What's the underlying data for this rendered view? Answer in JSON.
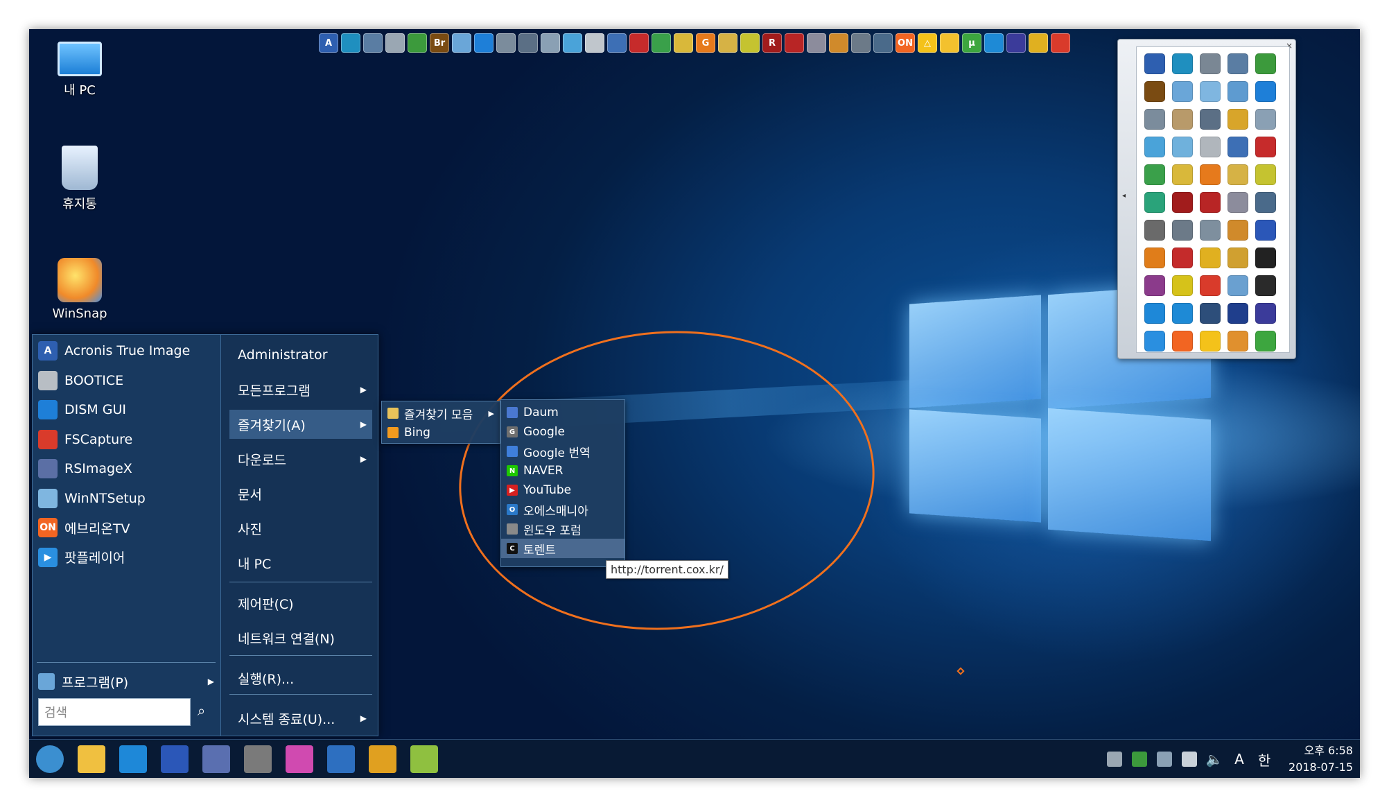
{
  "desktop": {
    "icons": [
      {
        "label": "내 PC"
      },
      {
        "label": "휴지통"
      },
      {
        "label": "WinSnap"
      }
    ]
  },
  "quick_launch": {
    "icons": [
      {
        "icon": "acronis-icon",
        "text": "A",
        "color": "#2e5fb0"
      },
      {
        "icon": "disk-icon",
        "text": "",
        "color": "#1f8fbf"
      },
      {
        "icon": "backup-icon",
        "text": "",
        "color": "#5a7da3"
      },
      {
        "icon": "drive-icon",
        "text": "",
        "color": "#9aa7b3"
      },
      {
        "icon": "hdd-icon",
        "text": "",
        "color": "#3c9a3c"
      },
      {
        "icon": "bridge-icon",
        "text": "Br",
        "color": "#7a4b12"
      },
      {
        "icon": "files-icon",
        "text": "",
        "color": "#6aa6d8"
      },
      {
        "icon": "windows-icon",
        "text": "",
        "color": "#1e7fd8"
      },
      {
        "icon": "network-icon",
        "text": "",
        "color": "#7b8c9c"
      },
      {
        "icon": "tools-icon",
        "text": "",
        "color": "#5b6f85"
      },
      {
        "icon": "usb-icon",
        "text": "",
        "color": "#8aa0b4"
      },
      {
        "icon": "phone-icon",
        "text": "",
        "color": "#4aa3d9"
      },
      {
        "icon": "bootice-icon",
        "text": "",
        "color": "#c0c6cc"
      },
      {
        "icon": "monitor-icon",
        "text": "",
        "color": "#3d6fb5"
      },
      {
        "icon": "car-icon",
        "text": "",
        "color": "#c62b2b"
      },
      {
        "icon": "paint-icon",
        "text": "",
        "color": "#3aa04a"
      },
      {
        "icon": "pinwheel-icon",
        "text": "",
        "color": "#d9b83a"
      },
      {
        "icon": "g-icon",
        "text": "G",
        "color": "#e67a1c"
      },
      {
        "icon": "wizard-icon",
        "text": "",
        "color": "#d6b245"
      },
      {
        "icon": "cube-icon",
        "text": "",
        "color": "#c5c330"
      },
      {
        "icon": "r-icon",
        "text": "R",
        "color": "#a11c1c"
      },
      {
        "icon": "dice-icon",
        "text": "",
        "color": "#b82525"
      },
      {
        "icon": "cd-icon",
        "text": "",
        "color": "#8c8c9c"
      },
      {
        "icon": "box-icon",
        "text": "",
        "color": "#d08a2b"
      },
      {
        "icon": "usb-stick-icon",
        "text": "",
        "color": "#6c7a88"
      },
      {
        "icon": "hdd2-icon",
        "text": "",
        "color": "#4a6a8a"
      },
      {
        "icon": "everon-icon",
        "text": "ON",
        "color": "#f26522"
      },
      {
        "icon": "triangle-icon",
        "text": "△",
        "color": "#f4c21a"
      },
      {
        "icon": "face-icon",
        "text": "",
        "color": "#f3c12e"
      },
      {
        "icon": "utorrent-icon",
        "text": "µ",
        "color": "#3da63f"
      },
      {
        "icon": "teamviewer-icon",
        "text": "",
        "color": "#1e8ad6"
      },
      {
        "icon": "chip-icon",
        "text": "",
        "color": "#3b3b9a"
      },
      {
        "icon": "keys-icon",
        "text": "",
        "color": "#e0b020"
      },
      {
        "icon": "fscapture-icon",
        "text": "",
        "color": "#d93b2b"
      }
    ]
  },
  "icon_panel": {
    "close": "×",
    "arrow": "◂",
    "cells": [
      {
        "icon": "acronis-icon",
        "color": "#2e5fb0"
      },
      {
        "icon": "disk-icon",
        "color": "#1f8fbf"
      },
      {
        "icon": "drive-icon",
        "color": "#7a8794"
      },
      {
        "icon": "backup-icon",
        "color": "#5a7da3"
      },
      {
        "icon": "hdd-icon",
        "color": "#3c9a3c"
      },
      {
        "icon": "bridge-icon",
        "color": "#7a4b12"
      },
      {
        "icon": "files-icon",
        "color": "#6aa6d8"
      },
      {
        "icon": "notes-icon",
        "color": "#7fb6e0"
      },
      {
        "icon": "puzzle-icon",
        "color": "#5e9bd0"
      },
      {
        "icon": "windows-icon",
        "color": "#1e7fd8"
      },
      {
        "icon": "network-icon",
        "color": "#7b8c9c"
      },
      {
        "icon": "printer-icon",
        "color": "#b89a6a"
      },
      {
        "icon": "tools-icon",
        "color": "#5b6f85"
      },
      {
        "icon": "gear-icon",
        "color": "#d8a52a"
      },
      {
        "icon": "usb-icon",
        "color": "#8aa0b4"
      },
      {
        "icon": "phone-icon",
        "color": "#4aa3d9"
      },
      {
        "icon": "tablet-icon",
        "color": "#6fb1dc"
      },
      {
        "icon": "bootice-icon",
        "color": "#b0b6bc"
      },
      {
        "icon": "monitor-icon",
        "color": "#3d6fb5"
      },
      {
        "icon": "car-icon",
        "color": "#c62b2b"
      },
      {
        "icon": "paint-icon",
        "color": "#3aa04a"
      },
      {
        "icon": "pinwheel-icon",
        "color": "#d9b83a"
      },
      {
        "icon": "g-icon",
        "color": "#e67a1c"
      },
      {
        "icon": "wizard-icon",
        "color": "#d6b245"
      },
      {
        "icon": "cube-icon",
        "color": "#c5c330"
      },
      {
        "icon": "rh-icon",
        "color": "#2aa37a"
      },
      {
        "icon": "r-icon",
        "color": "#a11c1c"
      },
      {
        "icon": "dice-icon",
        "color": "#b82525"
      },
      {
        "icon": "cd-icon",
        "color": "#8c8c9c"
      },
      {
        "icon": "hdd2-icon",
        "color": "#4a6a8a"
      },
      {
        "icon": "drive2-icon",
        "color": "#6a6a6a"
      },
      {
        "icon": "usb-stick-icon",
        "color": "#6c7a88"
      },
      {
        "icon": "ram-icon",
        "color": "#7e8f9e"
      },
      {
        "icon": "box-icon",
        "color": "#d08a2b"
      },
      {
        "icon": "save-icon",
        "color": "#2b57b8"
      },
      {
        "icon": "magnifier-icon",
        "color": "#e07d1a"
      },
      {
        "icon": "np-icon",
        "color": "#c42b2b"
      },
      {
        "icon": "keys-icon",
        "color": "#e0b020"
      },
      {
        "icon": "wand-icon",
        "color": "#d0a030"
      },
      {
        "icon": "7z-icon",
        "color": "#222222"
      },
      {
        "icon": "winrar-icon",
        "color": "#8b3b8b"
      },
      {
        "icon": "pdf-icon",
        "color": "#d6c21a"
      },
      {
        "icon": "fscapture-icon",
        "color": "#d93b2b"
      },
      {
        "icon": "winsnap-icon",
        "color": "#6aa0d0"
      },
      {
        "icon": "display-icon",
        "color": "#2a2a2a"
      },
      {
        "icon": "ie-icon",
        "color": "#1e88d8"
      },
      {
        "icon": "teamviewer-icon",
        "color": "#1e8ad6"
      },
      {
        "icon": "diagram-icon",
        "color": "#2d4e7a"
      },
      {
        "icon": "fc-icon",
        "color": "#1f3e8c"
      },
      {
        "icon": "chip-icon",
        "color": "#3b3b9a"
      },
      {
        "icon": "play-icon",
        "color": "#2a8fe0"
      },
      {
        "icon": "everon-icon",
        "color": "#f26522"
      },
      {
        "icon": "triangle-icon",
        "color": "#f4c21a"
      },
      {
        "icon": "face-icon",
        "color": "#e0902e"
      },
      {
        "icon": "utorrent-icon",
        "color": "#3da63f"
      }
    ]
  },
  "start_menu": {
    "pinned": [
      {
        "label": "Acronis True Image",
        "icon": "acronis-icon",
        "glyph": "A",
        "color": "#2e5fb0"
      },
      {
        "label": "BOOTICE",
        "icon": "bootice-icon",
        "glyph": "",
        "color": "#b8bec4"
      },
      {
        "label": "DISM GUI",
        "icon": "windows-icon",
        "glyph": "",
        "color": "#1e7fd8"
      },
      {
        "label": "FSCapture",
        "icon": "fscapture-icon",
        "glyph": "",
        "color": "#d93b2b"
      },
      {
        "label": "RSImageX",
        "icon": "rsimagex-icon",
        "glyph": "",
        "color": "#5b6fa5"
      },
      {
        "label": "WinNTSetup",
        "icon": "winntsetup-icon",
        "glyph": "",
        "color": "#7fb6e0"
      },
      {
        "label": "에브리온TV",
        "icon": "everon-icon",
        "glyph": "ON",
        "color": "#f26522"
      },
      {
        "label": "팟플레이어",
        "icon": "potplayer-icon",
        "glyph": "▶",
        "color": "#2a8fe0"
      }
    ],
    "programs": {
      "label": "프로그램(P)",
      "arrow": "▶"
    },
    "search_placeholder": "검색",
    "search_icon": "⌕",
    "right": [
      {
        "label": "Administrator",
        "arrow": ""
      },
      {
        "label": "모든프로그램",
        "arrow": "▶"
      },
      {
        "label": "즐겨찾기(A)",
        "arrow": "▶"
      },
      {
        "label": "다운로드",
        "arrow": "▶"
      },
      {
        "label": "문서",
        "arrow": ""
      },
      {
        "label": "사진",
        "arrow": ""
      },
      {
        "label": "내 PC",
        "arrow": ""
      },
      {
        "label": "제어판(C)",
        "arrow": ""
      },
      {
        "label": "네트워크 연결(N)",
        "arrow": ""
      },
      {
        "label": "실행(R)...",
        "arrow": ""
      },
      {
        "label": "시스템 종료(U)...",
        "arrow": "▶"
      }
    ]
  },
  "favorites_menu": [
    {
      "label": "즐겨찾기 모음",
      "arrow": "▶",
      "icon": "folder-icon",
      "color": "#e8c25a"
    },
    {
      "label": "Bing",
      "arrow": "",
      "icon": "bing-icon",
      "color": "#f29a1e"
    }
  ],
  "favorites_bar_menu": [
    {
      "label": "Daum",
      "icon": "daum-icon",
      "glyph": "",
      "color": "#4a78d0"
    },
    {
      "label": "Google",
      "icon": "google-icon",
      "glyph": "G",
      "color": "#6f6f6f"
    },
    {
      "label": "Google 번역",
      "icon": "translate-icon",
      "glyph": "",
      "color": "#3f7fdb"
    },
    {
      "label": "NAVER",
      "icon": "naver-icon",
      "glyph": "N",
      "color": "#1ec800"
    },
    {
      "label": "YouTube",
      "icon": "youtube-icon",
      "glyph": "▶",
      "color": "#d62020"
    },
    {
      "label": "오에스매니아",
      "icon": "osmania-icon",
      "glyph": "O",
      "color": "#2a78c8"
    },
    {
      "label": "윈도우 포럼",
      "icon": "winforum-icon",
      "glyph": "",
      "color": "#8a8a8a"
    },
    {
      "label": "토렌트",
      "icon": "torrent-icon",
      "glyph": "C",
      "color": "#111111"
    }
  ],
  "tooltip": "http://torrent.cox.kr/",
  "taskbar": {
    "buttons": [
      {
        "icon": "start-orb-icon",
        "color": "#3b8fd0"
      },
      {
        "icon": "explorer-icon",
        "color": "#f0c040"
      },
      {
        "icon": "ie-icon",
        "color": "#1e88d8"
      },
      {
        "icon": "save-icon",
        "color": "#2b57b8"
      },
      {
        "icon": "grid-icon",
        "color": "#5a6fb0"
      },
      {
        "icon": "transformer-icon",
        "color": "#7a7a7a"
      },
      {
        "icon": "color-icon",
        "color": "#d04ab0"
      },
      {
        "icon": "network-icon",
        "color": "#2d6fc0"
      },
      {
        "icon": "r-icon",
        "color": "#e0a020"
      },
      {
        "icon": "leaf-icon",
        "color": "#8fc040"
      }
    ],
    "tray": [
      {
        "icon": "tray-tool-icon",
        "glyph": "",
        "color": "#9aa7b3"
      },
      {
        "icon": "tray-network-icon",
        "glyph": "",
        "color": "#3c9a3c"
      },
      {
        "icon": "tray-usb-icon",
        "glyph": "",
        "color": "#8aa0b4"
      },
      {
        "icon": "tray-battery-icon",
        "glyph": "",
        "color": "#c9d1d9"
      },
      {
        "icon": "tray-volume-icon",
        "glyph": "🔈",
        "color": "transparent"
      },
      {
        "icon": "tray-ime-icon",
        "glyph": "A",
        "color": "transparent"
      },
      {
        "icon": "tray-hangul-icon",
        "glyph": "한",
        "color": "transparent"
      }
    ],
    "clock_time": "오후 6:58",
    "clock_date": "2018-07-15"
  },
  "accent": "#f0701d"
}
